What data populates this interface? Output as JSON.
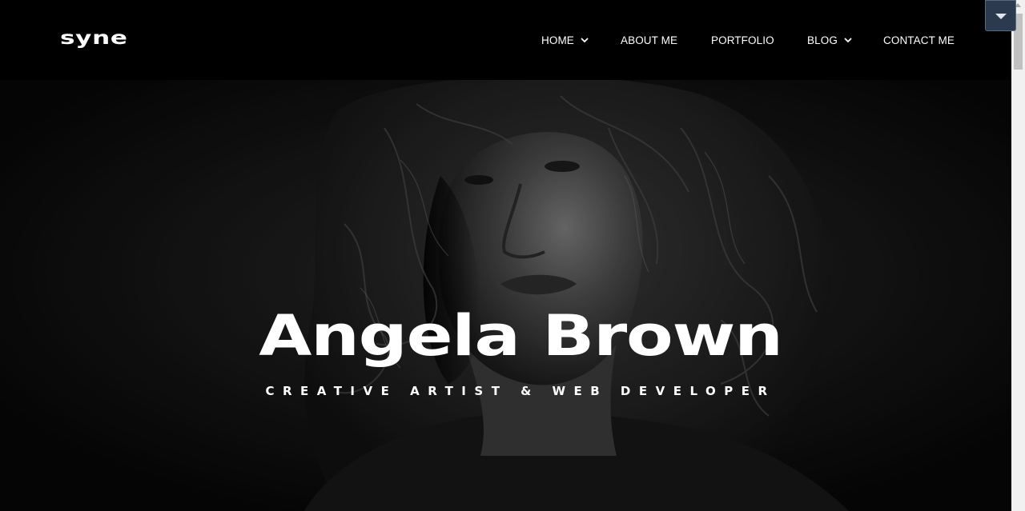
{
  "header": {
    "logo": "syne",
    "nav": [
      {
        "label": "HOME",
        "dropdown": true
      },
      {
        "label": "ABOUT ME",
        "dropdown": false
      },
      {
        "label": "PORTFOLIO",
        "dropdown": false
      },
      {
        "label": "BLOG",
        "dropdown": true
      },
      {
        "label": "CONTACT ME",
        "dropdown": false
      }
    ]
  },
  "hero": {
    "name": "Angela Brown",
    "tagline": "CREATIVE ARTIST & WEB DEVELOPER",
    "photo_icon": "portrait-photo"
  },
  "overlay": {
    "toggle_icon": "caret-down-icon"
  },
  "colors": {
    "background": "#000000",
    "text": "#ffffff",
    "widget": "#2c3a4f"
  }
}
